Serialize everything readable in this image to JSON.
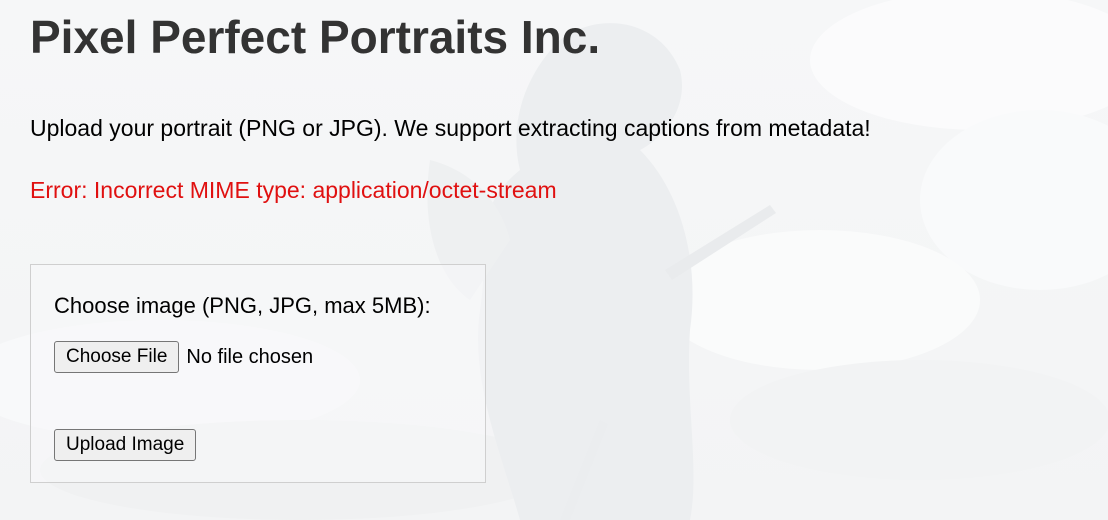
{
  "page": {
    "title": "Pixel Perfect Portraits Inc.",
    "intro": "Upload your portrait (PNG or JPG). We support extracting captions from metadata!",
    "error": "Error: Incorrect MIME type: application/octet-stream"
  },
  "upload_form": {
    "label": "Choose image (PNG, JPG, max 5MB):",
    "choose_file_label": "Choose File",
    "file_status": "No file chosen",
    "submit_label": "Upload Image"
  },
  "colors": {
    "title": "#333333",
    "error": "#e01010",
    "border": "#cfcfcf"
  }
}
